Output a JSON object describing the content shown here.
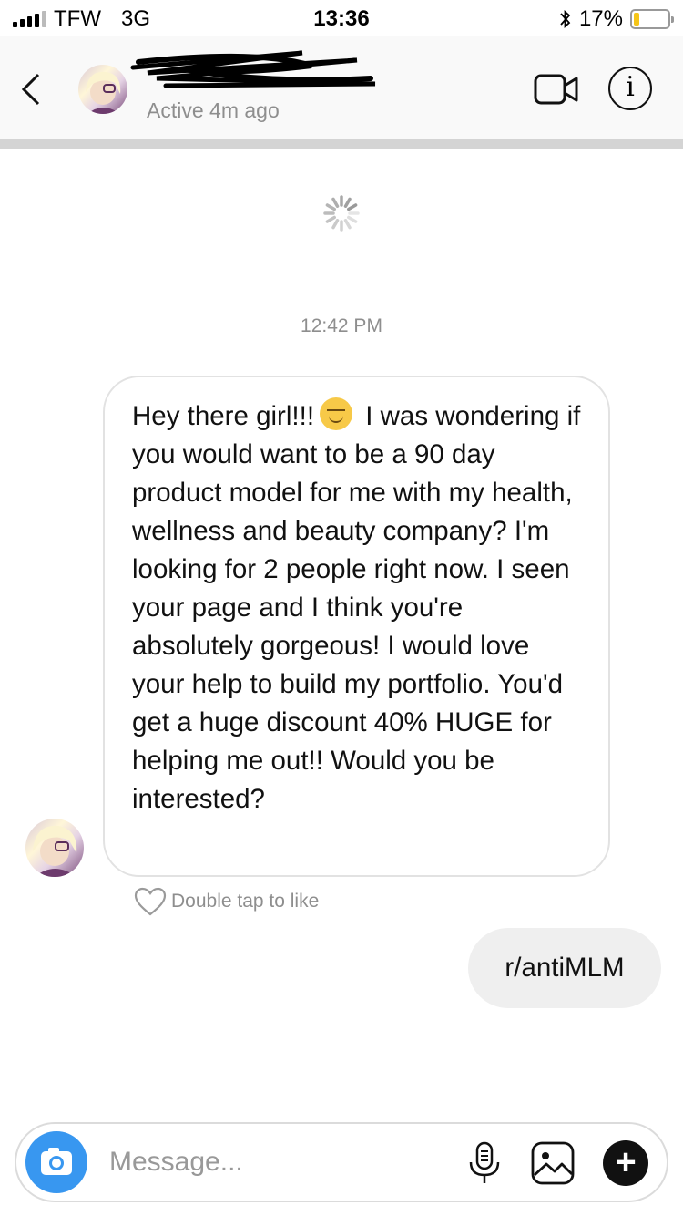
{
  "status_bar": {
    "carrier": "TFW",
    "network": "3G",
    "time": "13:36",
    "battery_percent_label": "17%",
    "battery_level": 0.17
  },
  "header": {
    "username": "",
    "active_status": "Active 4m ago"
  },
  "conversation": {
    "timestamp": "12:42 PM",
    "incoming_message": {
      "text_before_emoji": "Hey there girl!!!",
      "emoji": "smiling-face-emoji",
      "text_after_emoji": "I was wondering if you would want to be a 90 day product model for me with my health, wellness and beauty company? I'm looking for 2 people right now. I seen your page and I think you're absolutely gorgeous! I would love your help to build my portfolio. You'd get a huge discount 40% HUGE for helping me out!! Would you be interested?"
    },
    "like_hint": "Double tap to like",
    "outgoing_message": "r/antiMLM"
  },
  "composer": {
    "placeholder": "Message...",
    "value": ""
  },
  "colors": {
    "accent_blue": "#3897f0",
    "bubble_out_bg": "#efefef",
    "secondary_text": "#8e8e8e",
    "battery_fill": "#f5c518"
  },
  "icons": [
    "back-chevron-icon",
    "video-call-icon",
    "info-icon",
    "loading-spinner-icon",
    "heart-icon",
    "camera-icon",
    "microphone-icon",
    "gallery-icon",
    "plus-icon",
    "bluetooth-icon",
    "signal-icon",
    "battery-icon"
  ]
}
